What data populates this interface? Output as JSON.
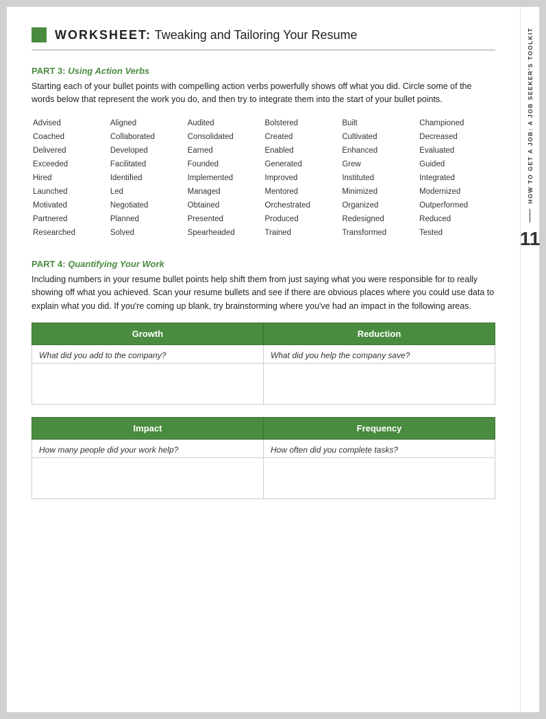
{
  "header": {
    "square_color": "#4a8c3f",
    "title_bold": "WORKSHEET:",
    "title_rest": "  Tweaking and Tailoring Your Resume"
  },
  "side_tab": {
    "text": "HOW TO GET A JOB: A JOB SEEKER'S TOOLKIT",
    "page_number": "11"
  },
  "part3": {
    "heading_label": "PART 3: ",
    "heading_italic": "Using Action Verbs",
    "body": "Starting each of your bullet points with compelling action verbs powerfully shows off what you did. Circle some of the words below that represent the work you do, and then try to integrate them into the start of your bullet points.",
    "verbs": [
      "Advised",
      "Aligned",
      "Audited",
      "Bolstered",
      "Built",
      "Championed",
      "Coached",
      "Collaborated",
      "Consolidated",
      "Created",
      "Cultivated",
      "Decreased",
      "Delivered",
      "Developed",
      "Earned",
      "Enabled",
      "Enhanced",
      "Evaluated",
      "Exceeded",
      "Facilitated",
      "Founded",
      "Generated",
      "Grew",
      "Guided",
      "Hired",
      "Identified",
      "Implemented",
      "Improved",
      "Instituted",
      "Integrated",
      "Launched",
      "Led",
      "Managed",
      "Mentored",
      "Minimized",
      "Modernized",
      "Motivated",
      "Negotiated",
      "Obtained",
      "Orchestrated",
      "Organized",
      "Outperformed",
      "Partnered",
      "Planned",
      "Presented",
      "Produced",
      "Redesigned",
      "Reduced",
      "Researched",
      "Solved",
      "Spearheaded",
      "Trained",
      "Transformed",
      "Tested"
    ]
  },
  "part4": {
    "heading_label": "PART 4: ",
    "heading_italic": "Quantifying Your Work",
    "body": "Including numbers in your resume bullet points help shift them from just saying what you were responsible for to really showing off what you achieved. Scan your resume bullets and see if there are obvious places where you could use data to explain what you did. If you're coming up blank, try brainstorming where you've had an impact in the following areas.",
    "table1": {
      "col1_header": "Growth",
      "col2_header": "Reduction",
      "col1_prompt": "What did you add to the company?",
      "col2_prompt": "What did you help the company save?"
    },
    "table2": {
      "col1_header": "Impact",
      "col2_header": "Frequency",
      "col1_prompt": "How many people did your work help?",
      "col2_prompt": "How often did you complete tasks?"
    }
  }
}
